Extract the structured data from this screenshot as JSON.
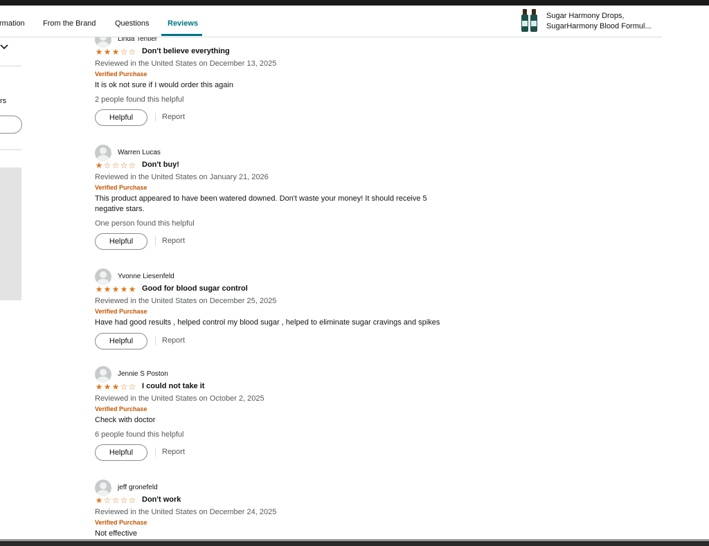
{
  "nav": {
    "tabs": [
      {
        "label": "rmation"
      },
      {
        "label": "From the Brand"
      },
      {
        "label": "Questions"
      },
      {
        "label": "Reviews"
      }
    ],
    "product": {
      "line1": "Sugar Harmony Drops,",
      "line2": "SugarHarmony Blood Formul..."
    }
  },
  "sidebar": {
    "fragment_text": "rs"
  },
  "reviews": [
    {
      "name": "Linda Tentler",
      "rating": 3,
      "title": "Don't believe everything",
      "meta": "Reviewed in the United States on December 13, 2025",
      "verified": "Verified Purchase",
      "body": "It is ok not sure if I would order this again",
      "helpful_count": "2 people found this helpful",
      "helpful_label": "Helpful",
      "report_label": "Report"
    },
    {
      "name": "Warren Lucas",
      "rating": 1,
      "title": "Don't buy!",
      "meta": "Reviewed in the United States on January 21, 2026",
      "verified": "Verified Purchase",
      "body": "This product appeared to have been watered downed. Don't waste your money! It should receive 5 negative stars.",
      "helpful_count": "One person found this helpful",
      "helpful_label": "Helpful",
      "report_label": "Report"
    },
    {
      "name": "Yvonne Liesenfeld",
      "rating": 5,
      "title": "Good for blood sugar control",
      "meta": "Reviewed in the United States on December 25, 2025",
      "verified": "Verified Purchase",
      "body": "Have had good results , helped control my blood sugar , helped to eliminate sugar cravings and spikes",
      "helpful_count": "",
      "helpful_label": "Helpful",
      "report_label": "Report"
    },
    {
      "name": "Jennie S Poston",
      "rating": 3,
      "title": "I could not take it",
      "meta": "Reviewed in the United States on October 2, 2025",
      "verified": "Verified Purchase",
      "body": "Check with doctor",
      "helpful_count": "6 people found this helpful",
      "helpful_label": "Helpful",
      "report_label": "Report"
    },
    {
      "name": "jeff gronefeld",
      "rating": 1,
      "title": "Don't work",
      "meta": "Reviewed in the United States on December 24, 2025",
      "verified": "Verified Purchase",
      "body": "Not effective",
      "helpful_count": "",
      "helpful_label": "Helpful",
      "report_label": "Report"
    }
  ],
  "colors": {
    "accent": "#007185",
    "star": "#de7921",
    "verified": "#c45500"
  }
}
